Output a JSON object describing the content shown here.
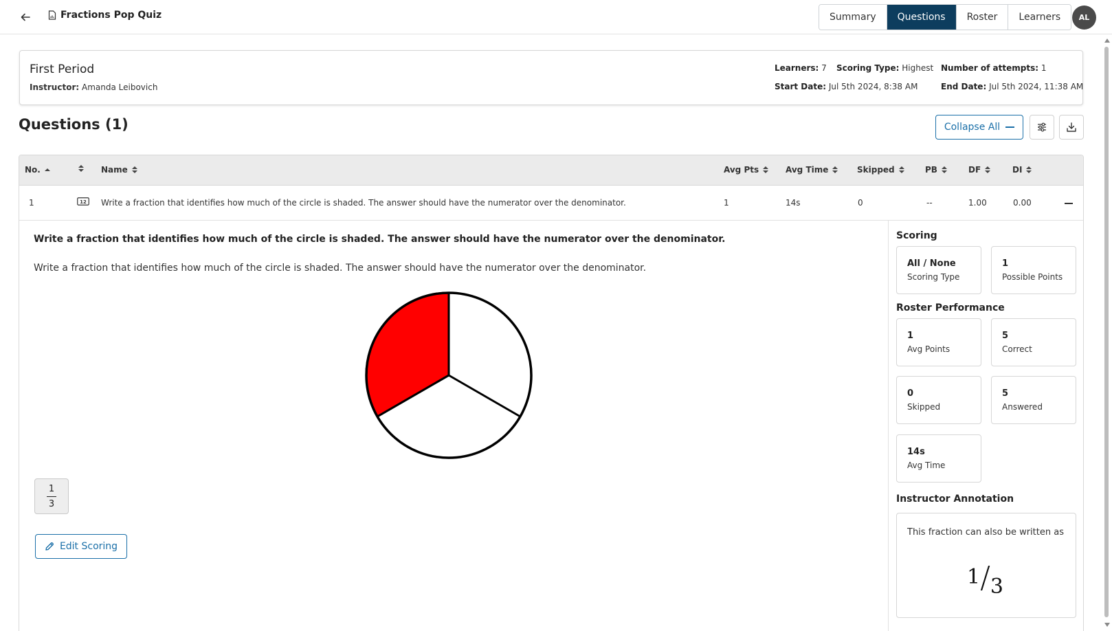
{
  "header": {
    "title": "Fractions Pop Quiz",
    "tabs": [
      {
        "label": "Summary",
        "active": false
      },
      {
        "label": "Questions",
        "active": true
      },
      {
        "label": "Roster",
        "active": false
      },
      {
        "label": "Learners",
        "active": false
      }
    ],
    "avatar_initials": "AL"
  },
  "info": {
    "period": "First Period",
    "instructor_label": "Instructor:",
    "instructor": "Amanda Leibovich",
    "learners_label": "Learners:",
    "learners": "7",
    "scoring_type_label": "Scoring Type:",
    "scoring_type": "Highest",
    "attempts_label": "Number of attempts:",
    "attempts": "1",
    "start_label": "Start Date:",
    "start_date": "Jul 5th 2024, 8:38 AM",
    "end_label": "End Date:",
    "end_date": "Jul 5th 2024, 11:38 AM"
  },
  "questions": {
    "title": "Questions (1)",
    "collapse_label": "Collapse All",
    "columns": {
      "no": "No.",
      "name": "Name",
      "avg_pts": "Avg Pts",
      "avg_time": "Avg Time",
      "skipped": "Skipped",
      "pb": "PB",
      "df": "DF",
      "di": "DI"
    },
    "rows": [
      {
        "no": "1",
        "type_icon": "numeric-answer-icon",
        "name": "Write a fraction that identifies how much of the circle is shaded. The answer should have the numerator over the denominator.",
        "avg_pts": "1",
        "avg_time": "14s",
        "skipped": "0",
        "pb": "--",
        "df": "1.00",
        "di": "0.00"
      }
    ]
  },
  "detail": {
    "question_bold": "Write a fraction that identifies how much of the circle is shaded. The answer should have the numerator over the denominator.",
    "question_text": "Write a fraction that identifies how much of the circle is shaded. The answer should have the numerator over the denominator.",
    "shade_color": "#ff0000",
    "answer_numerator": "1",
    "answer_denominator": "3",
    "edit_scoring_label": "Edit Scoring"
  },
  "sidebar": {
    "scoring_title": "Scoring",
    "scoring": [
      {
        "value": "All / None",
        "label": "Scoring Type"
      },
      {
        "value": "1",
        "label": "Possible Points"
      }
    ],
    "performance_title": "Roster Performance",
    "performance": [
      {
        "value": "1",
        "label": "Avg Points"
      },
      {
        "value": "5",
        "label": "Correct"
      },
      {
        "value": "0",
        "label": "Skipped"
      },
      {
        "value": "5",
        "label": "Answered"
      },
      {
        "value": "14s",
        "label": "Avg Time"
      }
    ],
    "annotation_title": "Instructor Annotation",
    "annotation_text": "This fraction can also be written as",
    "annotation_numerator": "1",
    "annotation_denominator": "3"
  },
  "colors": {
    "accent": "#1a6fa8",
    "active_tab": "#0d3d5e",
    "avatar": "#4a4a4a"
  }
}
